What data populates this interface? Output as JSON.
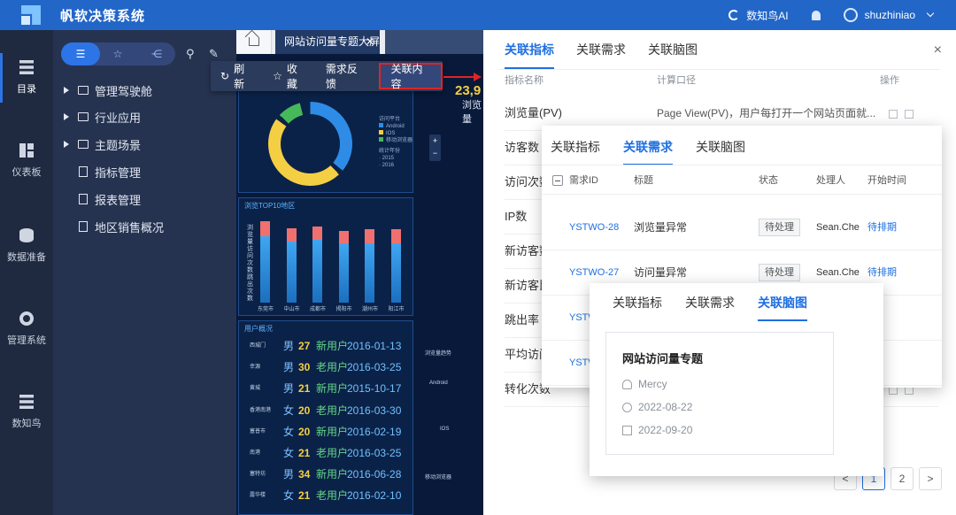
{
  "app": {
    "title": "帆软决策系统",
    "ai_label": "数知鸟AI",
    "username": "shuzhiniao"
  },
  "leftnav": [
    {
      "label": "目录",
      "icon": "list-icon"
    },
    {
      "label": "仪表板",
      "icon": "dashboard-icon"
    },
    {
      "label": "数据准备",
      "icon": "database-icon"
    },
    {
      "label": "管理系统",
      "icon": "gear-icon"
    },
    {
      "label": "数知鸟",
      "icon": "list-icon"
    }
  ],
  "tree": [
    {
      "label": "管理驾驶舱",
      "type": "folder"
    },
    {
      "label": "行业应用",
      "type": "folder"
    },
    {
      "label": "主题场景",
      "type": "folder"
    },
    {
      "label": "指标管理",
      "type": "doc"
    },
    {
      "label": "报表管理",
      "type": "doc"
    },
    {
      "label": "地区销售概况",
      "type": "doc"
    }
  ],
  "tabs": {
    "active": "网站访问量专题大屏"
  },
  "toolbar": {
    "refresh": "刷新",
    "favorite": "收藏",
    "feedback": "需求反馈",
    "related": "关联内容"
  },
  "dashboard": {
    "big_number": "23,9",
    "big_sub": "浏览量",
    "legend_title": "访问平台",
    "legend": [
      {
        "name": "Android",
        "color": "#2e8ce6"
      },
      {
        "name": "IOS",
        "color": "#f4cf44"
      },
      {
        "name": "移动浏览器",
        "color": "#46b95a"
      }
    ],
    "legend2_title": "统计年份",
    "legend2": [
      "2015",
      "2016"
    ],
    "top10_title": "浏览TOP10地区",
    "ylabel": "浏览量 访问次数 跳出次数",
    "users_title": "用户概况",
    "trend_title": "浏览量趋势",
    "platforms": [
      "Android",
      "IOS",
      "移动浏览器"
    ],
    "users": [
      {
        "city": "西城门",
        "gender": "男",
        "age": "27",
        "type": "新用户",
        "date": "2016-01-13"
      },
      {
        "city": "幸源",
        "gender": "男",
        "age": "30",
        "type": "老用户",
        "date": "2016-03-25"
      },
      {
        "city": "黄城",
        "gender": "男",
        "age": "21",
        "type": "新用户",
        "date": "2015-10-17"
      },
      {
        "city": "香港南港",
        "gender": "女",
        "age": "20",
        "type": "老用户",
        "date": "2016-03-30"
      },
      {
        "city": "塞普市",
        "gender": "女",
        "age": "20",
        "type": "新用户",
        "date": "2016-02-19"
      },
      {
        "city": "南港",
        "gender": "女",
        "age": "21",
        "type": "老用户",
        "date": "2016-03-25"
      },
      {
        "city": "塞特坊",
        "gender": "男",
        "age": "34",
        "type": "新用户",
        "date": "2016-06-28"
      },
      {
        "city": "露华楼",
        "gender": "女",
        "age": "21",
        "type": "老用户",
        "date": "2016-02-10"
      }
    ]
  },
  "chart_data": {
    "type": "bar",
    "title": "浏览TOP10地区",
    "categories": [
      "东莞市",
      "中山市",
      "成都市",
      "揭阳市",
      "潮州市",
      "阳江市"
    ],
    "series": [
      {
        "name": "访问次数",
        "values": [
          78,
          72,
          74,
          70,
          70,
          70
        ],
        "color": "#2e8ce6"
      },
      {
        "name": "跳出次数",
        "values": [
          18,
          16,
          16,
          14,
          16,
          16
        ],
        "color": "#f07070"
      }
    ],
    "ylim": [
      0,
      100
    ]
  },
  "drawer": {
    "tabs": [
      "关联指标",
      "关联需求",
      "关联脑图"
    ],
    "close": "×",
    "headers": {
      "name": "指标名称",
      "formula": "计算口径",
      "ops": "操作"
    },
    "rows": [
      {
        "name": "浏览量(PV)",
        "formula": "Page View(PV)，用户每打开一个网站页面就..."
      },
      {
        "name": "访客数",
        "formula": ""
      },
      {
        "name": "访问次数",
        "formula": ""
      },
      {
        "name": "IP数",
        "formula": ""
      },
      {
        "name": "新访客数",
        "formula": ""
      },
      {
        "name": "新访客比率",
        "formula": ""
      },
      {
        "name": "跳出率",
        "formula": ""
      },
      {
        "name": "平均访问时长",
        "formula": ""
      },
      {
        "name": "转化次数",
        "formula": ""
      }
    ],
    "pages": [
      "<",
      "1",
      "2",
      ">"
    ]
  },
  "req_card": {
    "tabs": [
      "关联指标",
      "关联需求",
      "关联脑图"
    ],
    "headers": {
      "id": "需求ID",
      "title": "标题",
      "status": "状态",
      "handler": "处理人",
      "start": "开始时间"
    },
    "rows": [
      {
        "id": "YSTWO-28",
        "title": "浏览量异常",
        "status": "待处理",
        "handler": "Sean.Che",
        "start": "待排期"
      },
      {
        "id": "YSTWO-27",
        "title": "访问量异常",
        "status": "待处理",
        "handler": "Sean.Che",
        "start": "待排期"
      },
      {
        "id": "YSTW",
        "title": "",
        "status": "",
        "handler": "",
        "start": "期"
      },
      {
        "id": "YSTW",
        "title": "",
        "status": "",
        "handler": "",
        "start": "期"
      }
    ]
  },
  "mind_card": {
    "tabs": [
      "关联指标",
      "关联需求",
      "关联脑图"
    ],
    "title": "网站访问量专题",
    "author": "Mercy",
    "created": "2022-08-22",
    "edited": "2022-09-20"
  }
}
